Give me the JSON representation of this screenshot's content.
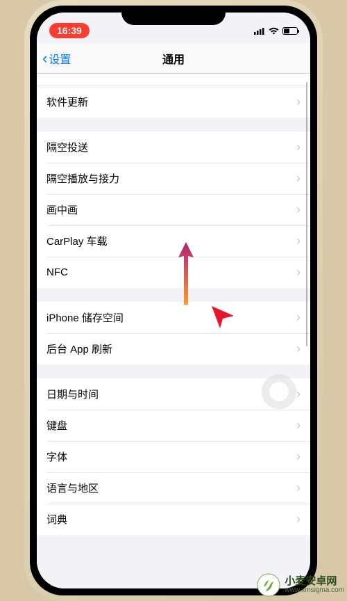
{
  "status": {
    "time": "16:39"
  },
  "nav": {
    "back": "设置",
    "title": "通用"
  },
  "groups": [
    {
      "rows": [
        {
          "label": "软件更新"
        }
      ],
      "partialTop": true
    },
    {
      "rows": [
        {
          "label": "隔空投送"
        },
        {
          "label": "隔空播放与接力"
        },
        {
          "label": "画中画"
        },
        {
          "label": "CarPlay 车载"
        },
        {
          "label": "NFC"
        }
      ]
    },
    {
      "rows": [
        {
          "label": "iPhone 储存空间"
        },
        {
          "label": "后台 App 刷新"
        }
      ]
    },
    {
      "rows": [
        {
          "label": "日期与时间"
        },
        {
          "label": "键盘"
        },
        {
          "label": "字体"
        },
        {
          "label": "语言与地区"
        },
        {
          "label": "词典"
        }
      ]
    }
  ],
  "watermark": {
    "cn": "小麦安卓网",
    "url": "www.xmsigma.com"
  }
}
